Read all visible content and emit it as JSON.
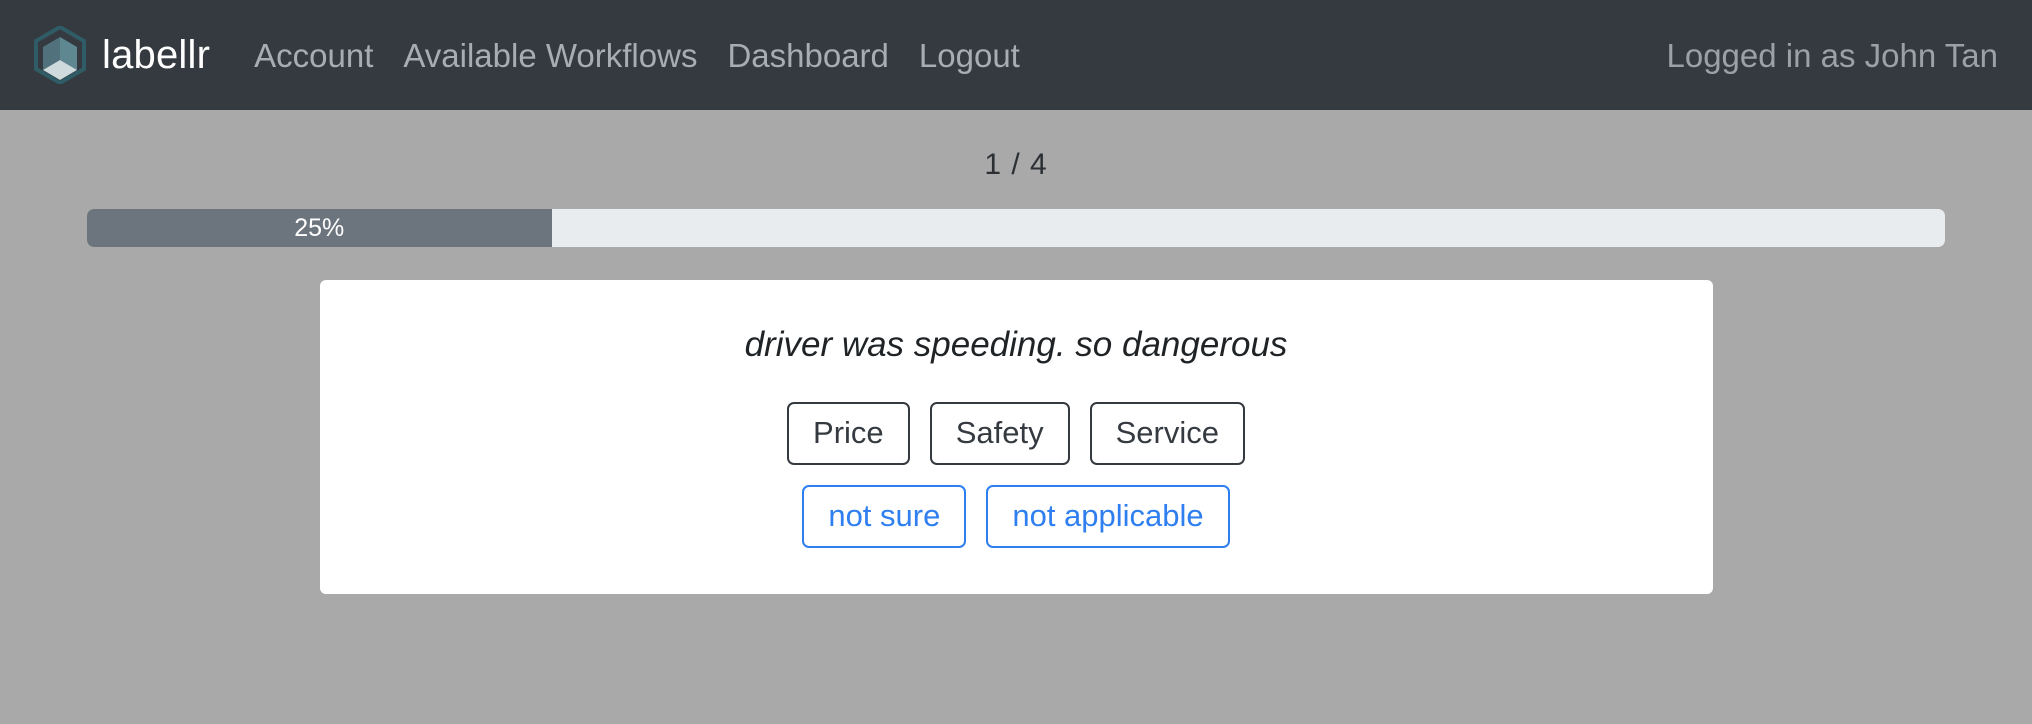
{
  "navbar": {
    "brand": {
      "logo_icon": "cube-logo-icon",
      "name": "labellr"
    },
    "links": [
      {
        "label": "Account",
        "name": "nav-link-account"
      },
      {
        "label": "Available Workflows",
        "name": "nav-link-available-workflows"
      },
      {
        "label": "Dashboard",
        "name": "nav-link-dashboard"
      },
      {
        "label": "Logout",
        "name": "nav-link-logout"
      }
    ],
    "user_status": "Logged in as John Tan"
  },
  "main": {
    "counter": "1 / 4",
    "progress": {
      "label": "25%",
      "percent": 25,
      "fill_color": "#6c757d",
      "track_color": "#e9ecef"
    },
    "card": {
      "question": "driver was speeding. so dangerous",
      "label_buttons": [
        {
          "label": "Price",
          "name": "label-button-price"
        },
        {
          "label": "Safety",
          "name": "label-button-safety"
        },
        {
          "label": "Service",
          "name": "label-button-service"
        }
      ],
      "fallback_buttons": [
        {
          "label": "not sure",
          "name": "label-button-not-sure"
        },
        {
          "label": "not applicable",
          "name": "label-button-not-applicable"
        }
      ]
    }
  },
  "colors": {
    "navbar_bg": "#343a40",
    "page_bg": "#a9a9a9",
    "primary": "#2f7ff0",
    "dark": "#343a40"
  }
}
